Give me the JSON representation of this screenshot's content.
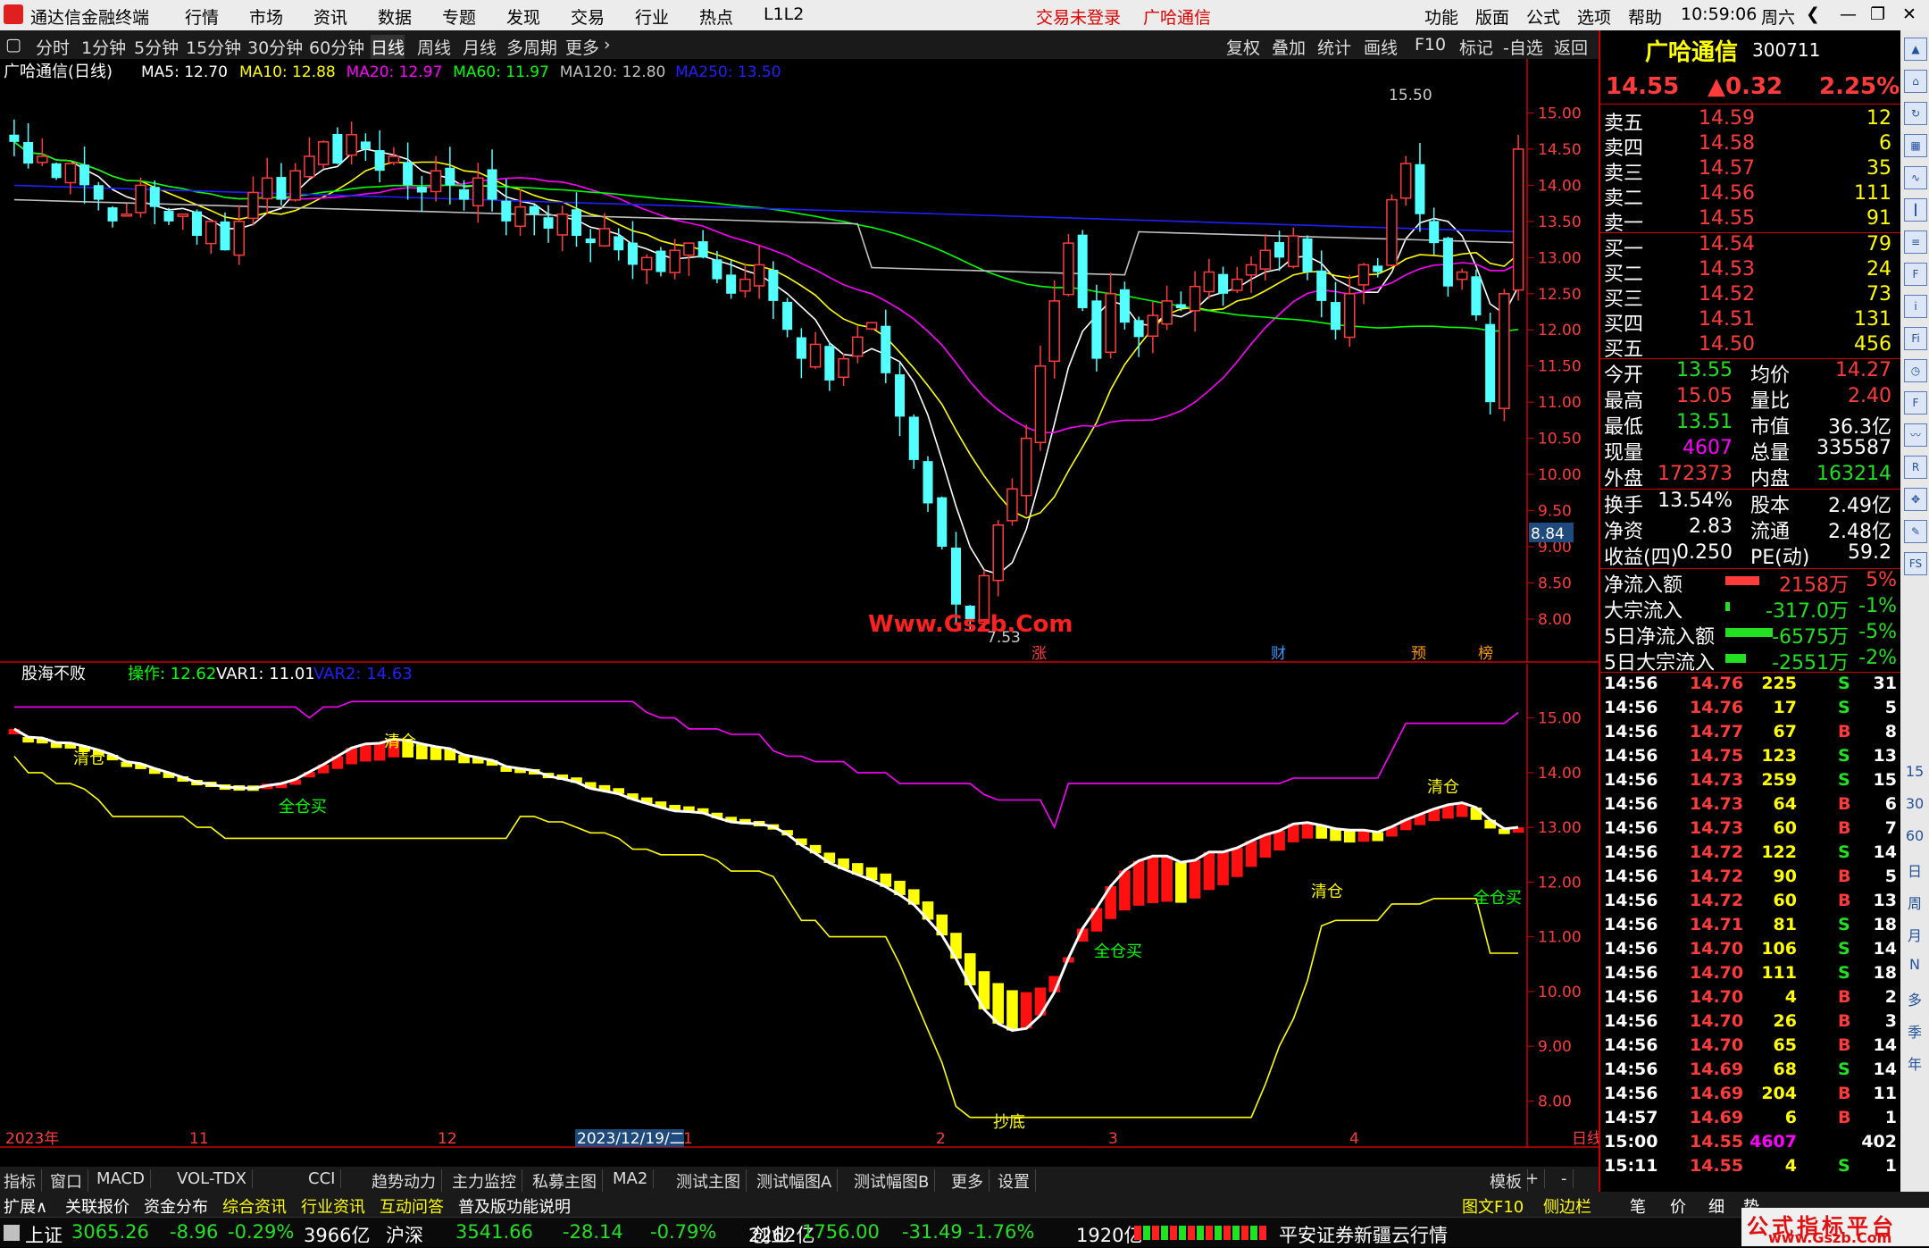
{
  "menu": {
    "app_title": "通达信金融终端",
    "items": [
      "行情",
      "市场",
      "资讯",
      "数据",
      "专题",
      "发现",
      "交易",
      "行业",
      "热点",
      "L1L2"
    ],
    "trade_status": "交易未登录",
    "stock_name": "广哈通信",
    "right_items": [
      "功能",
      "版面",
      "公式",
      "选项",
      "帮助"
    ],
    "time": "10:59:06",
    "weekday": "周六"
  },
  "toolbar": {
    "periods": [
      "分时",
      "1分钟",
      "5分钟",
      "15分钟",
      "30分钟",
      "60分钟",
      "日线",
      "周线",
      "月线",
      "多周期",
      "更多"
    ],
    "active": "日线",
    "right": [
      "复权",
      "叠加",
      "统计",
      "画线",
      "F10",
      "标记",
      "-自选",
      "返回"
    ]
  },
  "main_chart": {
    "title": "广哈通信(日线)",
    "ma": [
      {
        "label": "MA5: 12.70",
        "color": "#ffffff"
      },
      {
        "label": "MA10: 12.88",
        "color": "#ffff00"
      },
      {
        "label": "MA20: 12.97",
        "color": "#ff00ff"
      },
      {
        "label": "MA60: 11.97",
        "color": "#00ff00"
      },
      {
        "label": "MA120: 12.80",
        "color": "#c0c0c0"
      },
      {
        "label": "MA250: 13.50",
        "color": "#2020ff"
      }
    ],
    "high_label": "15.50",
    "low_label": "7.53",
    "cursor_price": "8.84",
    "watermark": "Www.Gszb.Com",
    "event_markers": [
      {
        "label": "涨",
        "color": "#ff3b3b"
      },
      {
        "label": "财",
        "color": "#3399ff"
      },
      {
        "label": "预",
        "color": "#ff9900"
      },
      {
        "label": "榜",
        "color": "#ff9900"
      }
    ]
  },
  "sub_chart": {
    "title": "股海不败",
    "indicators": [
      {
        "label": "操作: 12.62",
        "color": "#00ff00"
      },
      {
        "label": "VAR1: 11.01",
        "color": "#ffffff"
      },
      {
        "label": "VAR2: 14.63",
        "color": "#2020ff"
      }
    ],
    "signals": [
      "清仓",
      "全仓买",
      "清仓",
      "全仓买",
      "清仓",
      "清仓",
      "全仓买",
      "抄底"
    ]
  },
  "chart_data": [
    {
      "type": "line",
      "name": "price-candles",
      "yaxis": [
        15.0,
        14.5,
        14.0,
        13.5,
        13.0,
        12.5,
        12.0,
        11.5,
        11.0,
        10.5,
        10.0,
        9.5,
        9.0,
        8.5,
        8.0
      ],
      "ylim": [
        7.53,
        15.5
      ],
      "x_labels": [
        "2023年",
        "11",
        "12",
        "2023/12/19/二",
        "1",
        "2",
        "3",
        "4",
        "日线"
      ],
      "close": [
        14.6,
        14.3,
        14.4,
        14.1,
        14.3,
        14.0,
        13.8,
        13.5,
        13.6,
        14.0,
        13.7,
        13.5,
        13.6,
        13.3,
        13.5,
        13.1,
        13.5,
        13.9,
        14.1,
        13.8,
        14.2,
        14.4,
        14.6,
        14.3,
        14.7,
        14.5,
        14.2,
        14.4,
        14.0,
        13.9,
        14.2,
        14.0,
        13.8,
        14.1,
        13.8,
        13.5,
        13.7,
        13.6,
        13.4,
        13.6,
        13.3,
        13.2,
        13.4,
        13.1,
        12.9,
        13.0,
        12.8,
        13.1,
        13.2,
        13.0,
        12.7,
        12.5,
        12.7,
        12.9,
        12.4,
        12.0,
        11.6,
        11.8,
        11.3,
        11.6,
        11.9,
        12.1,
        11.4,
        10.8,
        10.2,
        9.6,
        9.0,
        8.2,
        8.0,
        8.6,
        9.3,
        9.8,
        10.5,
        11.5,
        12.4,
        13.2,
        12.3,
        11.6,
        12.5,
        12.1,
        11.9,
        12.2,
        12.4,
        12.3,
        12.6,
        12.8,
        12.5,
        12.7,
        12.9,
        13.1,
        13.0,
        13.3,
        12.8,
        12.4,
        12.0,
        12.5,
        12.9,
        12.8,
        13.8,
        14.3,
        13.6,
        13.2,
        12.6,
        12.8,
        12.2,
        11.0,
        12.5,
        14.5
      ],
      "series": [
        {
          "name": "MA5",
          "color": "#ffffff"
        },
        {
          "name": "MA10",
          "color": "#ffff00"
        },
        {
          "name": "MA20",
          "color": "#ff00ff"
        },
        {
          "name": "MA60",
          "color": "#00ff00"
        },
        {
          "name": "MA120",
          "color": "#c0c0c0"
        },
        {
          "name": "MA250",
          "color": "#2020ff"
        }
      ]
    },
    {
      "type": "line",
      "name": "股海不败",
      "yaxis": [
        15.0,
        14.0,
        13.0,
        12.0,
        11.0,
        10.0,
        9.0,
        8.0
      ],
      "ylim": [
        7.5,
        15.5
      ],
      "series": [
        {
          "name": "VAR1",
          "color": "#ffffff"
        },
        {
          "name": "VAR2",
          "color": "#ff00ff"
        },
        {
          "name": "操作",
          "color": "#ffff00"
        }
      ]
    }
  ],
  "quote": {
    "name": "广哈通信",
    "code": "300711",
    "price": "14.55",
    "change": "▲0.32",
    "pct": "2.25%",
    "asks": [
      {
        "label": "卖五",
        "price": "14.59",
        "vol": "12"
      },
      {
        "label": "卖四",
        "price": "14.58",
        "vol": "6"
      },
      {
        "label": "卖三",
        "price": "14.57",
        "vol": "35"
      },
      {
        "label": "卖二",
        "price": "14.56",
        "vol": "111"
      },
      {
        "label": "卖一",
        "price": "14.55",
        "vol": "91"
      }
    ],
    "bids": [
      {
        "label": "买一",
        "price": "14.54",
        "vol": "79"
      },
      {
        "label": "买二",
        "price": "14.53",
        "vol": "24"
      },
      {
        "label": "买三",
        "price": "14.52",
        "vol": "73"
      },
      {
        "label": "买四",
        "price": "14.51",
        "vol": "131"
      },
      {
        "label": "买五",
        "price": "14.50",
        "vol": "456"
      }
    ],
    "stats": [
      {
        "l1": "今开",
        "v1": "13.55",
        "c1": "green",
        "l2": "均价",
        "v2": "14.27",
        "c2": "red"
      },
      {
        "l1": "最高",
        "v1": "15.05",
        "c1": "red",
        "l2": "量比",
        "v2": "2.40",
        "c2": "red"
      },
      {
        "l1": "最低",
        "v1": "13.51",
        "c1": "green",
        "l2": "市值",
        "v2": "36.3亿",
        "c2": "lbl"
      },
      {
        "l1": "现量",
        "v1": "4607",
        "c1": "mag",
        "l2": "总量",
        "v2": "335587",
        "c2": "lbl"
      },
      {
        "l1": "外盘",
        "v1": "172373",
        "c1": "red",
        "l2": "内盘",
        "v2": "163214",
        "c2": "green"
      }
    ],
    "stats2": [
      {
        "l1": "换手",
        "v1": "13.54%",
        "c1": "lbl",
        "l2": "股本",
        "v2": "2.49亿",
        "c2": "lbl"
      },
      {
        "l1": "净资",
        "v1": "2.83",
        "c1": "lbl",
        "l2": "流通",
        "v2": "2.48亿",
        "c2": "lbl"
      },
      {
        "l1": "收益(四)",
        "v1": "0.250",
        "c1": "lbl",
        "l2": "PE(动)",
        "v2": "59.2",
        "c2": "lbl"
      }
    ],
    "flows": [
      {
        "label": "净流入额",
        "value": "2158万",
        "pct": "5%",
        "c": "red",
        "bar": 0.25
      },
      {
        "label": "大宗流入",
        "value": "-317.0万",
        "pct": "-1%",
        "c": "green",
        "bar": 0.03
      },
      {
        "label": "5日净流入额",
        "value": "-6575万",
        "pct": "-5%",
        "c": "green",
        "bar": 0.35
      },
      {
        "label": "5日大宗流入",
        "value": "-2551万",
        "pct": "-2%",
        "c": "green",
        "bar": 0.15
      }
    ],
    "ticks": [
      {
        "t": "14:56",
        "p": "14.76",
        "v": "225",
        "s": "S",
        "n": "31"
      },
      {
        "t": "14:56",
        "p": "14.76",
        "v": "17",
        "s": "S",
        "n": "5"
      },
      {
        "t": "14:56",
        "p": "14.77",
        "v": "67",
        "s": "B",
        "n": "8"
      },
      {
        "t": "14:56",
        "p": "14.75",
        "v": "123",
        "s": "S",
        "n": "13"
      },
      {
        "t": "14:56",
        "p": "14.73",
        "v": "259",
        "s": "S",
        "n": "15"
      },
      {
        "t": "14:56",
        "p": "14.73",
        "v": "64",
        "s": "B",
        "n": "6"
      },
      {
        "t": "14:56",
        "p": "14.73",
        "v": "60",
        "s": "B",
        "n": "7"
      },
      {
        "t": "14:56",
        "p": "14.72",
        "v": "122",
        "s": "S",
        "n": "14"
      },
      {
        "t": "14:56",
        "p": "14.72",
        "v": "90",
        "s": "B",
        "n": "5"
      },
      {
        "t": "14:56",
        "p": "14.72",
        "v": "60",
        "s": "B",
        "n": "13"
      },
      {
        "t": "14:56",
        "p": "14.71",
        "v": "81",
        "s": "S",
        "n": "18"
      },
      {
        "t": "14:56",
        "p": "14.70",
        "v": "106",
        "s": "S",
        "n": "14"
      },
      {
        "t": "14:56",
        "p": "14.70",
        "v": "111",
        "s": "S",
        "n": "18"
      },
      {
        "t": "14:56",
        "p": "14.70",
        "v": "4",
        "s": "B",
        "n": "2"
      },
      {
        "t": "14:56",
        "p": "14.70",
        "v": "26",
        "s": "B",
        "n": "3"
      },
      {
        "t": "14:56",
        "p": "14.70",
        "v": "65",
        "s": "B",
        "n": "14"
      },
      {
        "t": "14:56",
        "p": "14.69",
        "v": "68",
        "s": "S",
        "n": "14"
      },
      {
        "t": "14:56",
        "p": "14.69",
        "v": "204",
        "s": "B",
        "n": "11"
      },
      {
        "t": "14:57",
        "p": "14.69",
        "v": "6",
        "s": "B",
        "n": "1"
      },
      {
        "t": "15:00",
        "p": "14.55",
        "v": "4607",
        "s": "",
        "n": "402"
      },
      {
        "t": "15:11",
        "p": "14.55",
        "v": "4",
        "s": "S",
        "n": "1"
      }
    ]
  },
  "strip": {
    "icons": [
      "up-arrow-icon",
      "home-icon",
      "refresh-icon",
      "grid-icon",
      "chart-icon",
      "candle-icon",
      "list-icon",
      "f10-icon",
      "info-icon",
      "fiz-icon",
      "clock-icon",
      "f-icon",
      "wave-icon",
      "rsi-icon",
      "cross-icon",
      "pen-icon",
      "fs-icon"
    ],
    "periods": [
      "15",
      "30",
      "60",
      "日",
      "周",
      "月",
      "N",
      "多",
      "季",
      "年"
    ]
  },
  "tabs1": {
    "items": [
      "指标",
      "窗口",
      "MACD",
      "VOL-TDX",
      "CCI",
      "趋势动力",
      "主力监控",
      "私募主图",
      "MA2",
      "测试主图",
      "测试幅图A",
      "测试幅图B",
      "更多",
      "设置"
    ],
    "right": [
      "模板",
      "+",
      "-"
    ]
  },
  "tabs2": {
    "items": [
      {
        "label": "扩展∧",
        "c": "#ffffff"
      },
      {
        "label": "关联报价",
        "c": "#ffffff"
      },
      {
        "label": "资金分布",
        "c": "#ffffff"
      },
      {
        "label": "综合资讯",
        "c": "#ffff00"
      },
      {
        "label": "行业资讯",
        "c": "#ffff00"
      },
      {
        "label": "互动问答",
        "c": "#ffff00"
      },
      {
        "label": "普及版功能说明",
        "c": "#ffffff"
      }
    ],
    "right": [
      "图文F10",
      "侧边栏",
      "笔",
      "价",
      "细",
      "势"
    ]
  },
  "status": {
    "idx": [
      {
        "name": "上证",
        "v": "3065.26",
        "d": "-8.96",
        "p": "-0.29%",
        "amt": "3966亿"
      },
      {
        "name": "沪深",
        "v": "3541.66",
        "d": "-28.14",
        "p": "-0.79%",
        "amt": "2262亿"
      },
      {
        "name": "创业",
        "v": "1756.00",
        "d": "-31.49",
        "p": "-1.76%",
        "amt": "1920亿"
      }
    ],
    "server": "平安证券新疆云行情",
    "site_name": "公式指标平台",
    "site_url": "www.Gszb.Com"
  }
}
